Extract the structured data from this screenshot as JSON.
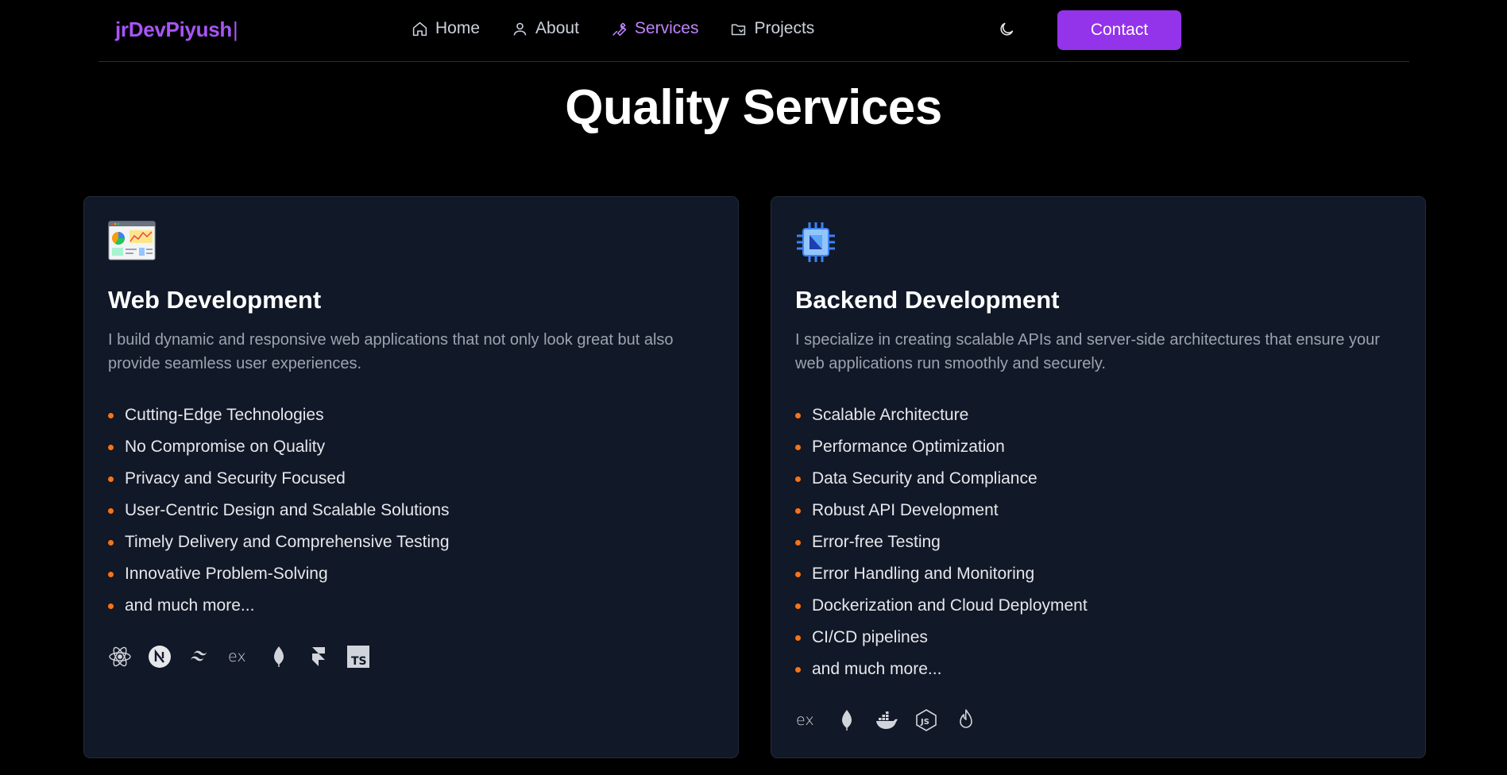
{
  "nav": {
    "logo": "jrDevPiyush",
    "caret": "|",
    "items": [
      {
        "label": "Home",
        "icon": "home-icon",
        "active": false
      },
      {
        "label": "About",
        "icon": "user-icon",
        "active": false
      },
      {
        "label": "Services",
        "icon": "wrench-icon",
        "active": true
      },
      {
        "label": "Projects",
        "icon": "folder-icon",
        "active": false
      }
    ],
    "theme_icon": "moon-icon",
    "contact_label": "Contact"
  },
  "page_title": "Quality Services",
  "colors": {
    "accent": "#9333ea",
    "active_link": "#c084fc",
    "bullet": "#f97316",
    "card_bg": "#111827"
  },
  "services": [
    {
      "icon": "dashboard-illustration-icon",
      "title": "Web Development",
      "description": "I build dynamic and responsive web applications that not only look great but also provide seamless user experiences.",
      "features": [
        "Cutting-Edge Technologies",
        "No Compromise on Quality",
        "Privacy and Security Focused",
        "User-Centric Design and Scalable Solutions",
        "Timely Delivery and Comprehensive Testing",
        "Innovative Problem-Solving",
        "and much more..."
      ],
      "tech_icons": [
        "react-icon",
        "nextjs-icon",
        "tailwind-icon",
        "express-icon",
        "mongodb-icon",
        "framer-icon",
        "typescript-icon"
      ]
    },
    {
      "icon": "cpu-chip-icon",
      "title": "Backend Development",
      "description": "I specialize in creating scalable APIs and server-side architectures that ensure your web applications run smoothly and securely.",
      "features": [
        "Scalable Architecture",
        "Performance Optimization",
        "Data Security and Compliance",
        "Robust API Development",
        "Error-free Testing",
        "Error Handling and Monitoring",
        "Dockerization and Cloud Deployment",
        "CI/CD pipelines",
        "and much more..."
      ],
      "tech_icons": [
        "express-icon",
        "mongodb-icon",
        "docker-icon",
        "nodejs-icon",
        "firebase-icon"
      ]
    }
  ]
}
